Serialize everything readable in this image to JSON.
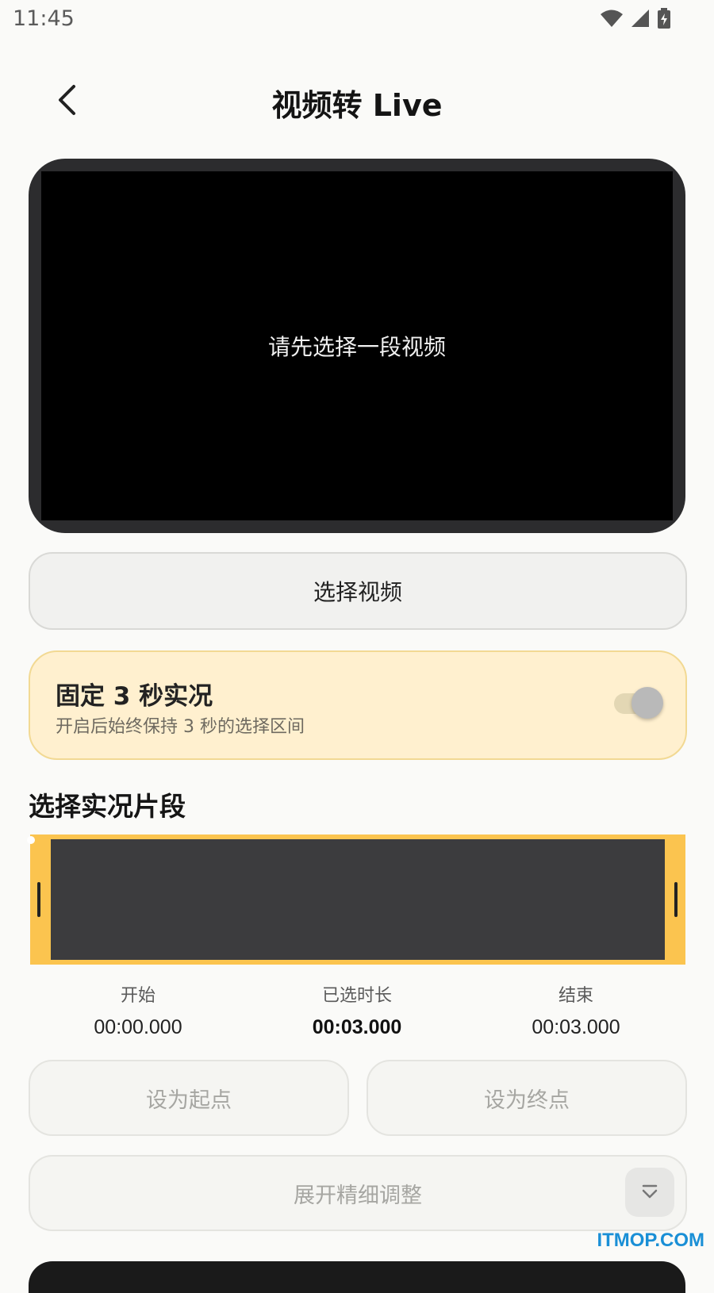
{
  "status_bar": {
    "time": "11:45"
  },
  "header": {
    "title": "视频转 Live"
  },
  "preview": {
    "placeholder": "请先选择一段视频"
  },
  "choose_video_label": "选择视频",
  "fixed_card": {
    "title": "固定 3 秒实况",
    "subtitle": "开启后始终保持 3 秒的选择区间",
    "toggle_on": true
  },
  "section_title": "选择实况片段",
  "stats": {
    "start_label": "开始",
    "start_value": "00:00.000",
    "duration_label": "已选时长",
    "duration_value": "00:03.000",
    "end_label": "结束",
    "end_value": "00:03.000"
  },
  "buttons": {
    "set_start": "设为起点",
    "set_end": "设为终点",
    "expand_fine_tune": "展开精细调整"
  },
  "watermark": "ITMOP.COM",
  "colors": {
    "accent": "#fbc44f",
    "card_bg": "#fff0cf",
    "track": "#3c3c3e"
  }
}
